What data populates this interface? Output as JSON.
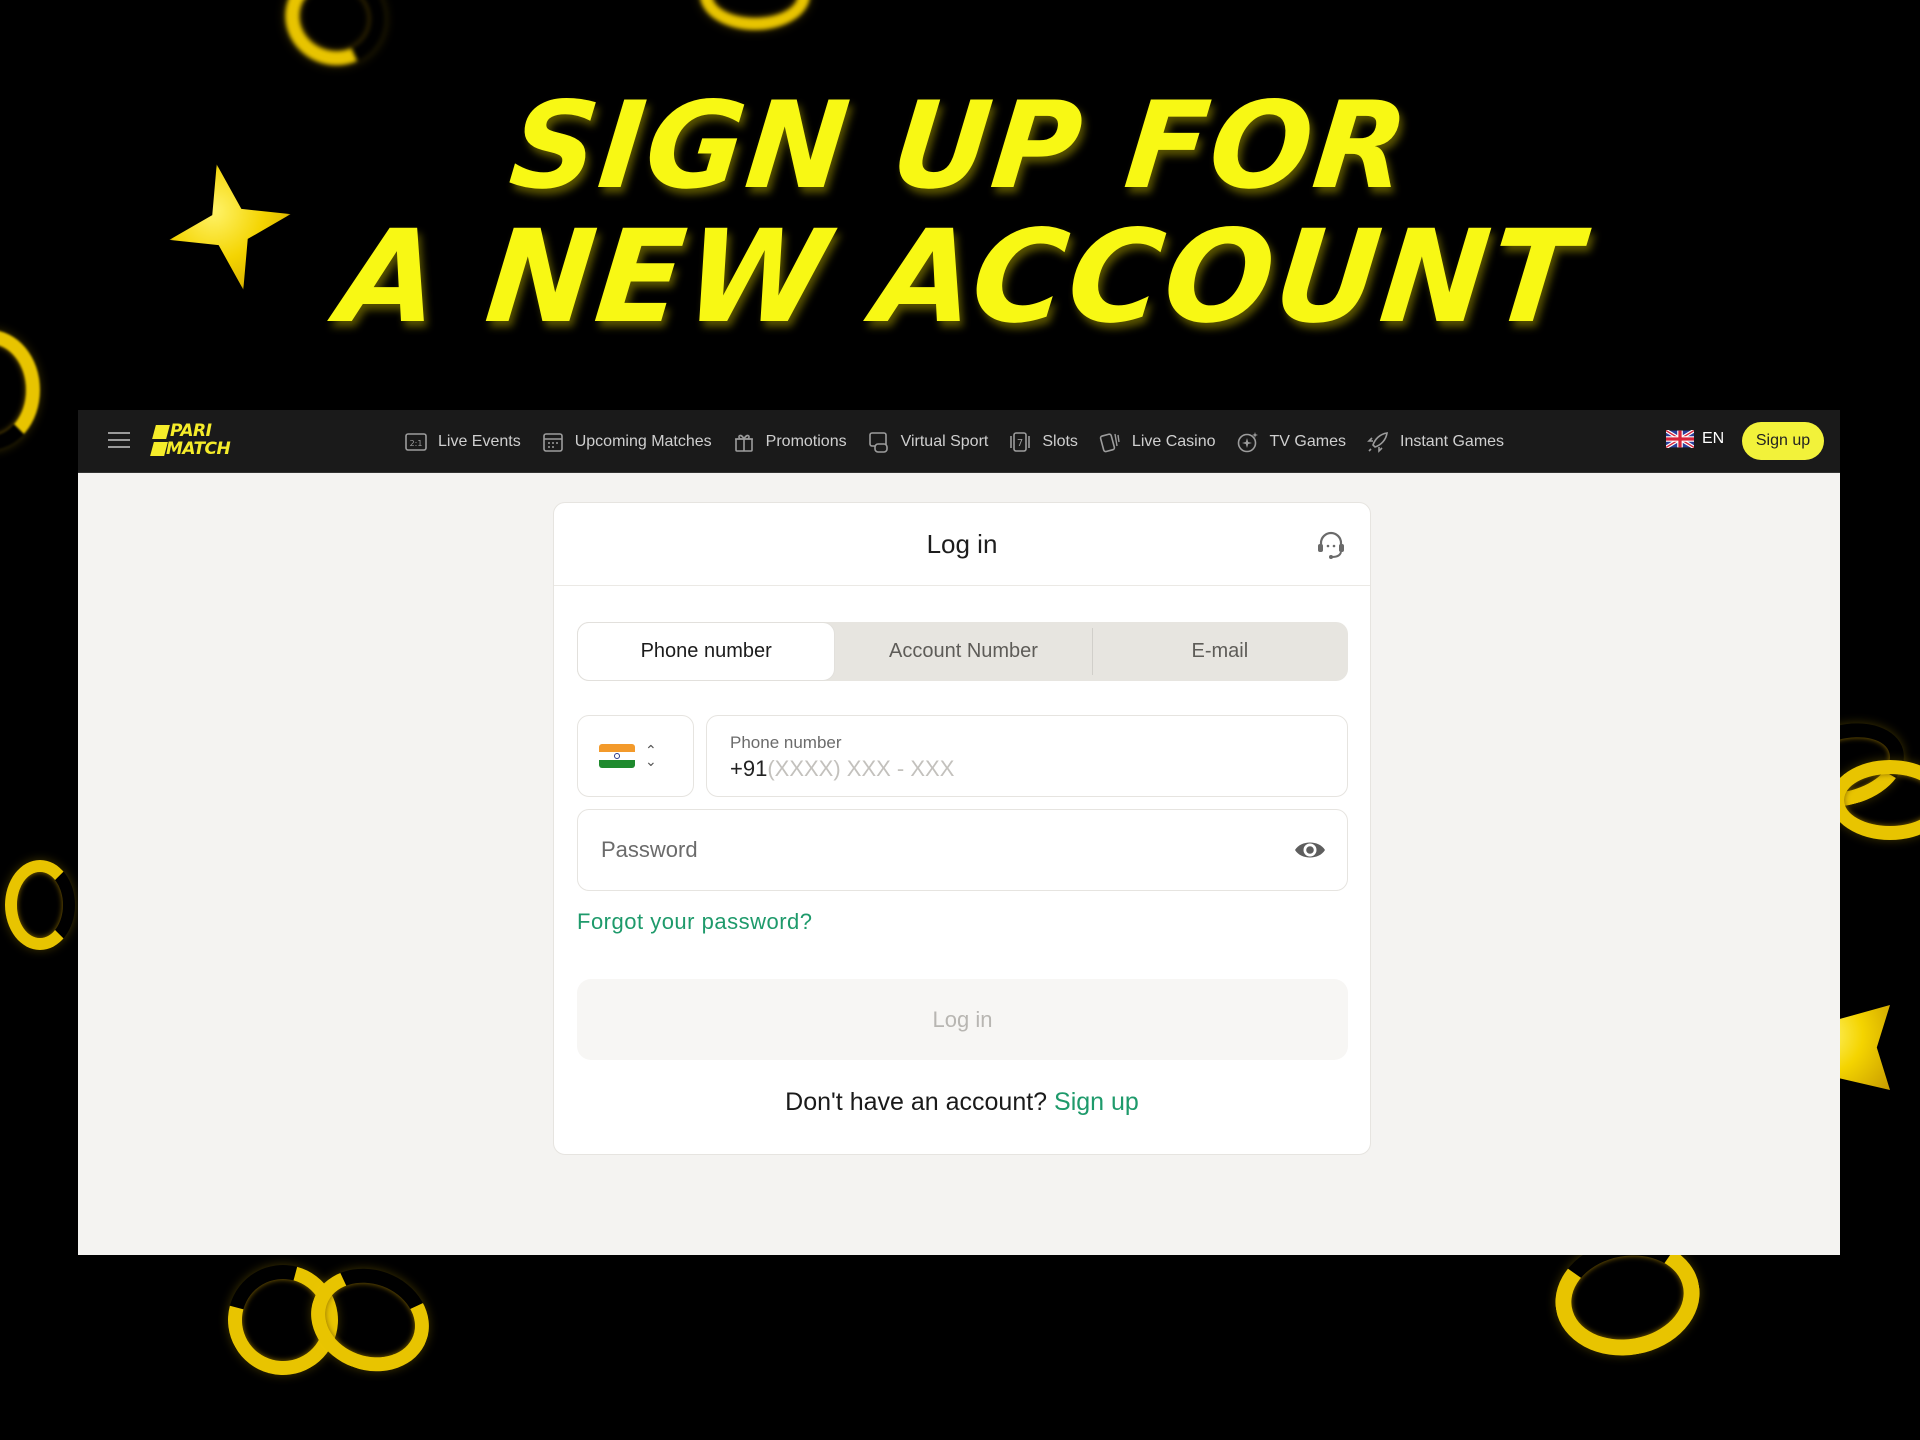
{
  "headline": {
    "line1": "SIGN UP FOR",
    "line2": "A NEW ACCOUNT",
    "color": "#f8f814"
  },
  "nav": {
    "logo": {
      "line1": "PARI",
      "line2": "MATCH"
    },
    "items": [
      {
        "label": "Live Events",
        "icon": "live-score-icon"
      },
      {
        "label": "Upcoming Matches",
        "icon": "calendar-icon"
      },
      {
        "label": "Promotions",
        "icon": "gift-icon"
      },
      {
        "label": "Virtual Sport",
        "icon": "gamepad-icon"
      },
      {
        "label": "Slots",
        "icon": "slot-seven-icon"
      },
      {
        "label": "Live Casino",
        "icon": "cards-icon"
      },
      {
        "label": "TV Games",
        "icon": "sparkle-icon"
      },
      {
        "label": "Instant Games",
        "icon": "rocket-icon"
      }
    ],
    "language": "EN",
    "signup_label": "Sign up",
    "live_icon_text": "2:1",
    "slot_icon_text": "7"
  },
  "login": {
    "title": "Log in",
    "tabs": [
      {
        "label": "Phone number",
        "active": true
      },
      {
        "label": "Account Number",
        "active": false
      },
      {
        "label": "E-mail",
        "active": false
      }
    ],
    "phone": {
      "label": "Phone number",
      "prefix": "+91",
      "mask": "(XXXX) XXX - XXX",
      "country": "India"
    },
    "password_placeholder": "Password",
    "forgot_label": "Forgot your password?",
    "submit_label": "Log in",
    "footer_text": "Don't have an account?",
    "footer_link": "Sign up"
  },
  "colors": {
    "accent_yellow": "#f2f23a",
    "link_green": "#1e9a6b",
    "nav_bg": "#1a1a1a"
  }
}
